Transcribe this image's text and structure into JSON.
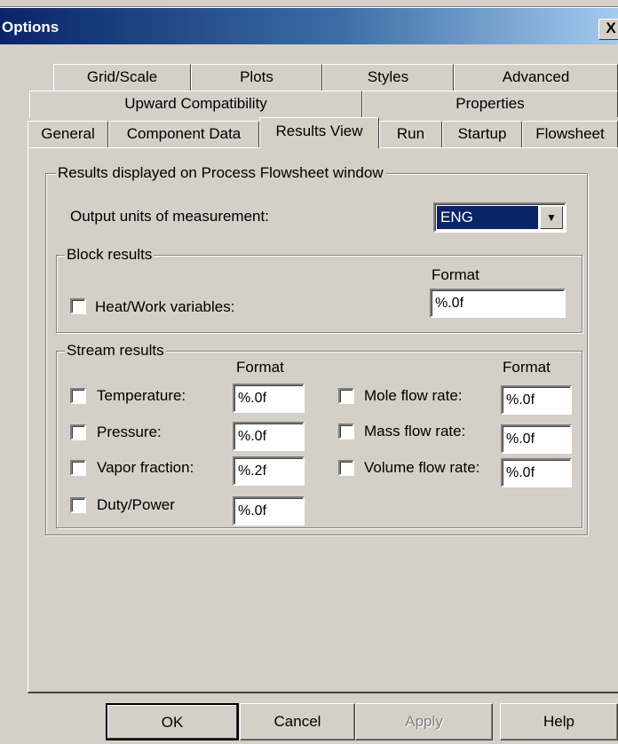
{
  "window": {
    "title": "Options",
    "close_glyph": "X"
  },
  "tabs": {
    "row1": [
      "Grid/Scale",
      "Plots",
      "Styles",
      "Advanced"
    ],
    "row2": [
      "Upward Compatibility",
      "Properties"
    ],
    "row3": [
      "General",
      "Component Data",
      "Results View",
      "Run",
      "Startup",
      "Flowsheet"
    ],
    "active": "Results View"
  },
  "results_group": {
    "legend": "Results displayed on Process Flowsheet window",
    "output_units_label": "Output units of measurement:",
    "output_units_value": "ENG"
  },
  "block_results": {
    "legend": "Block results",
    "format_header": "Format",
    "heat_work_label": "Heat/Work variables:",
    "heat_work_format": "%.0f",
    "heat_work_checked": false
  },
  "stream_results": {
    "legend": "Stream results",
    "format_header_left": "Format",
    "format_header_right": "Format",
    "left": [
      {
        "label": "Temperature:",
        "format": "%.0f",
        "checked": false
      },
      {
        "label": "Pressure:",
        "format": "%.0f",
        "checked": false
      },
      {
        "label": "Vapor fraction:",
        "format": "%.2f",
        "checked": false
      },
      {
        "label": "Duty/Power",
        "format": "%.0f",
        "checked": false
      }
    ],
    "right": [
      {
        "label": "Mole flow rate:",
        "format": "%.0f",
        "checked": false
      },
      {
        "label": "Mass flow rate:",
        "format": "%.0f",
        "checked": false
      },
      {
        "label": "Volume flow rate:",
        "format": "%.0f",
        "checked": false
      }
    ]
  },
  "buttons": {
    "ok": "OK",
    "cancel": "Cancel",
    "apply": "Apply",
    "help": "Help"
  }
}
